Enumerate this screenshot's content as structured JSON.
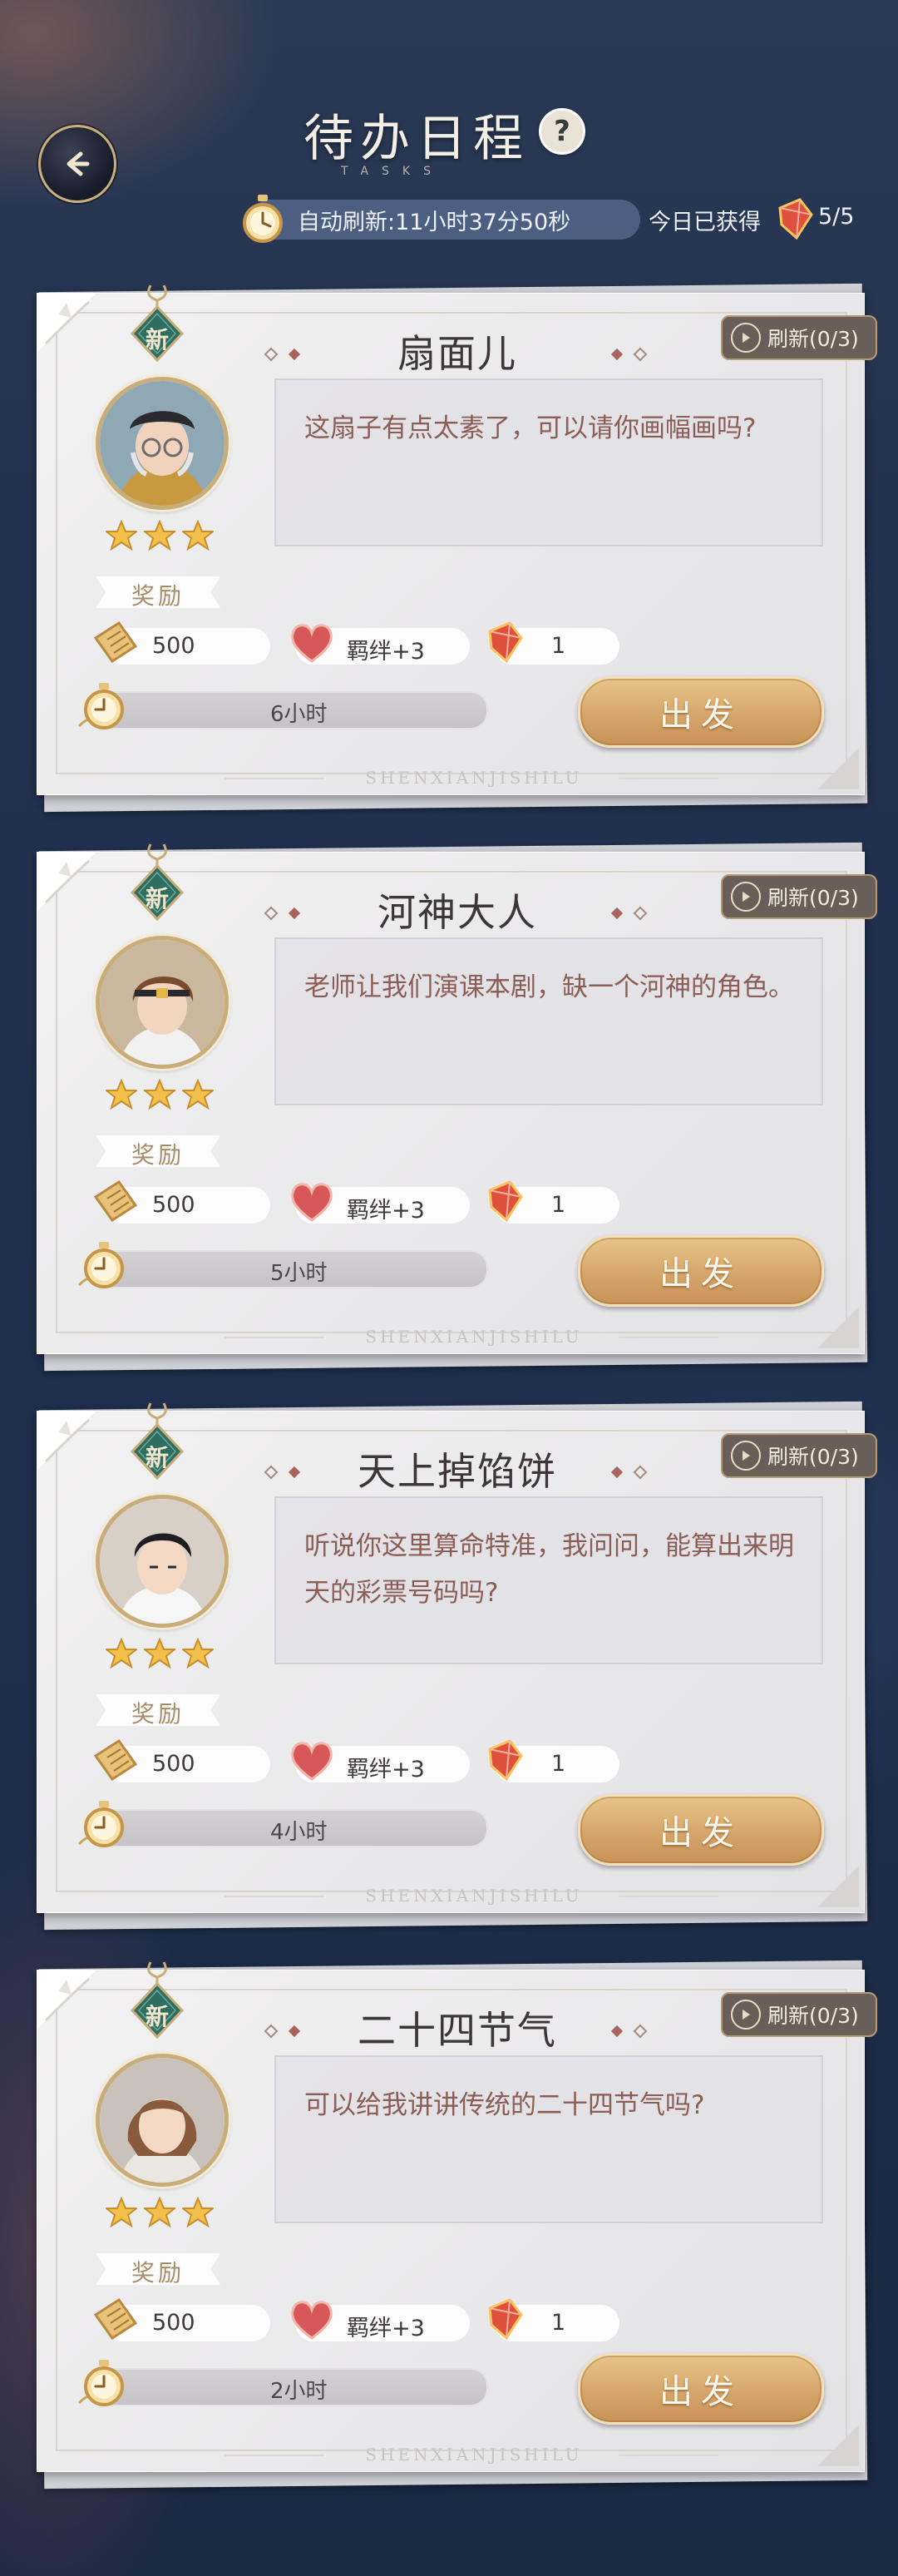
{
  "header": {
    "title": "待办日程",
    "subtitle": "TASKS",
    "help_label": "?",
    "refresh_text": "自动刷新:11小时37分50秒",
    "today_label": "今日已获得",
    "today_count": "5/5"
  },
  "icons": {
    "back": "back-arrow-icon",
    "help": "question-icon",
    "stopwatch": "stopwatch-icon",
    "gem": "red-gem-icon",
    "coin": "gold-ticket-icon",
    "heart": "heart-icon",
    "star": "star-icon"
  },
  "colors": {
    "accent_gold": "#d6a66a",
    "dialog_text": "#8a5d55",
    "background": "#1f2f4e"
  },
  "tasks": [
    {
      "badge": "新",
      "title": "扇面儿",
      "refresh_label": "刷新(0/3)",
      "dialog": "这扇子有点太素了，可以请你画幅画吗?",
      "stars": 3,
      "reward_label": "奖励",
      "reward_coins": "500",
      "reward_bond": "羁绊+3",
      "reward_gems": "1",
      "duration": "6小时",
      "go_label": "出发",
      "footer": "SHENXIANJISHILU"
    },
    {
      "badge": "新",
      "title": "河神大人",
      "refresh_label": "刷新(0/3)",
      "dialog": "老师让我们演课本剧，缺一个河神的角色。",
      "stars": 3,
      "reward_label": "奖励",
      "reward_coins": "500",
      "reward_bond": "羁绊+3",
      "reward_gems": "1",
      "duration": "5小时",
      "go_label": "出发",
      "footer": "SHENXIANJISHILU"
    },
    {
      "badge": "新",
      "title": "天上掉馅饼",
      "refresh_label": "刷新(0/3)",
      "dialog": "听说你这里算命特准，我问问，能算出来明天的彩票号码吗?",
      "stars": 3,
      "reward_label": "奖励",
      "reward_coins": "500",
      "reward_bond": "羁绊+3",
      "reward_gems": "1",
      "duration": "4小时",
      "go_label": "出发",
      "footer": "SHENXIANJISHILU"
    },
    {
      "badge": "新",
      "title": "二十四节气",
      "refresh_label": "刷新(0/3)",
      "dialog": "可以给我讲讲传统的二十四节气吗?",
      "stars": 3,
      "reward_label": "奖励",
      "reward_coins": "500",
      "reward_bond": "羁绊+3",
      "reward_gems": "1",
      "duration": "2小时",
      "go_label": "出发",
      "footer": "SHENXIANJISHILU"
    }
  ]
}
